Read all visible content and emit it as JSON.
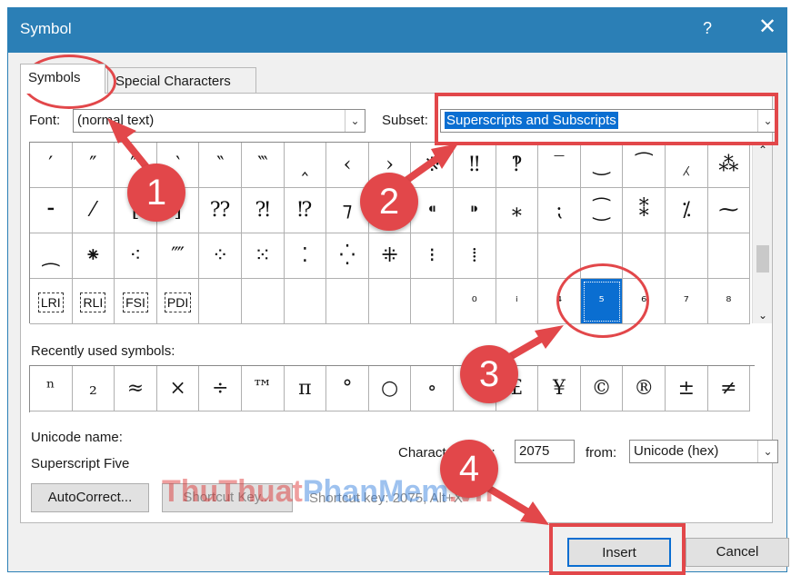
{
  "window": {
    "title": "Symbol",
    "help": "?",
    "close": "✕"
  },
  "tabs": [
    {
      "label": "Symbols"
    },
    {
      "label": "Special Characters"
    }
  ],
  "font": {
    "label": "Font:",
    "value": "(normal text)"
  },
  "subset": {
    "label": "Subset:",
    "value": "Superscripts and Subscripts"
  },
  "grid": {
    "rows": [
      [
        "′",
        "″",
        "‴",
        "‵",
        "‶",
        "‷",
        "‸",
        "‹",
        "›",
        "※",
        "‼",
        "‽",
        "‾",
        "‿",
        "⁀",
        "⁁",
        "⁂"
      ],
      [
        "⁃",
        "⁄",
        "⁅",
        "⁆",
        "⁇",
        "⁈",
        "⁉",
        "⁊",
        "⁋",
        "⁌",
        "⁍",
        "⁎",
        "⁏",
        "⁐",
        "⁑",
        "⁒",
        "⁓"
      ],
      [
        "⁔",
        "⁕",
        "⁖",
        "⁗",
        "⁘",
        "⁙",
        "⁚",
        "⁛",
        "⁜",
        "⁝",
        "⁞",
        "",
        "",
        "",
        "",
        "",
        ""
      ],
      [
        "LRI",
        "RLI",
        "FSI",
        "PDI",
        "",
        "",
        "",
        "",
        "",
        "",
        "⁰",
        "ⁱ",
        "⁴",
        "⁵",
        "⁶",
        "⁷",
        "⁸"
      ]
    ],
    "selected": "⁵"
  },
  "recent": {
    "label": "Recently used symbols:",
    "items": [
      "ⁿ",
      "₂",
      "≈",
      "×",
      "÷",
      "™",
      "π",
      "°",
      "○",
      "∘",
      "€",
      "£",
      "¥",
      "©",
      "®",
      "±",
      "≠"
    ]
  },
  "unicode": {
    "name_label": "Unicode name:",
    "name_value": "Superscript Five"
  },
  "char_code": {
    "label": "Character code:",
    "value": "2075",
    "from_label": "from:",
    "from_value": "Unicode (hex)"
  },
  "buttons": {
    "autocorrect": "AutoCorrect...",
    "shortcut_key": "Shortcut Key...",
    "shortcut_text": "Shortcut key: 2075, Alt+X",
    "insert": "Insert",
    "cancel": "Cancel"
  },
  "badges": [
    "1",
    "2",
    "3",
    "4"
  ],
  "watermark": {
    "part1": "ThuThuat",
    "part2": "PhanMem",
    "part3": ".vn"
  },
  "colors": {
    "titlebar": "#2b7fb6",
    "accent": "#0a6ed1",
    "annotation": "#e2474a"
  }
}
